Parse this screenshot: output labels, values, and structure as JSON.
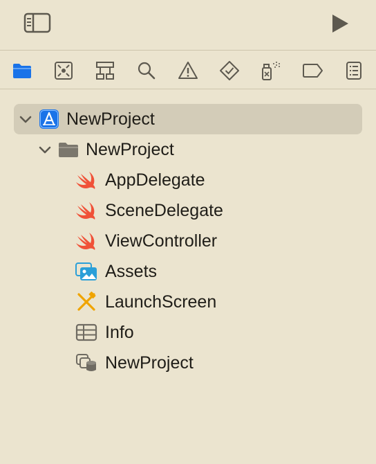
{
  "toolbar": {
    "sidebar_toggle_icon": "sidebar-left-icon",
    "run_icon": "play-icon"
  },
  "navigator_tabs": [
    {
      "id": "project",
      "icon": "folder-icon",
      "active": true
    },
    {
      "id": "source-control",
      "icon": "source-control-icon",
      "active": false
    },
    {
      "id": "symbols",
      "icon": "hierarchy-icon",
      "active": false
    },
    {
      "id": "find",
      "icon": "search-icon",
      "active": false
    },
    {
      "id": "issues",
      "icon": "warning-icon",
      "active": false
    },
    {
      "id": "tests",
      "icon": "diamond-check-icon",
      "active": false
    },
    {
      "id": "debug",
      "icon": "spray-icon",
      "active": false
    },
    {
      "id": "breakpoints",
      "icon": "tag-icon",
      "active": false
    },
    {
      "id": "reports",
      "icon": "report-icon",
      "active": false
    }
  ],
  "tree": {
    "project": {
      "label": "NewProject",
      "icon": "xcode-project-icon"
    },
    "group": {
      "label": "NewProject",
      "icon": "folder-icon"
    },
    "files": [
      {
        "label": "AppDelegate",
        "icon": "swift-icon"
      },
      {
        "label": "SceneDelegate",
        "icon": "swift-icon"
      },
      {
        "label": "ViewController",
        "icon": "swift-icon"
      },
      {
        "label": "Assets",
        "icon": "asset-catalog-icon"
      },
      {
        "label": "LaunchScreen",
        "icon": "storyboard-icon"
      },
      {
        "label": "Info",
        "icon": "plist-icon"
      },
      {
        "label": "NewProject",
        "icon": "data-model-icon"
      }
    ]
  },
  "colors": {
    "background": "#ebe4cf",
    "accent": "#1a73e8",
    "swift": "#f05138",
    "icon_gray": "#5d594f",
    "selection": "#d3ccb8"
  }
}
